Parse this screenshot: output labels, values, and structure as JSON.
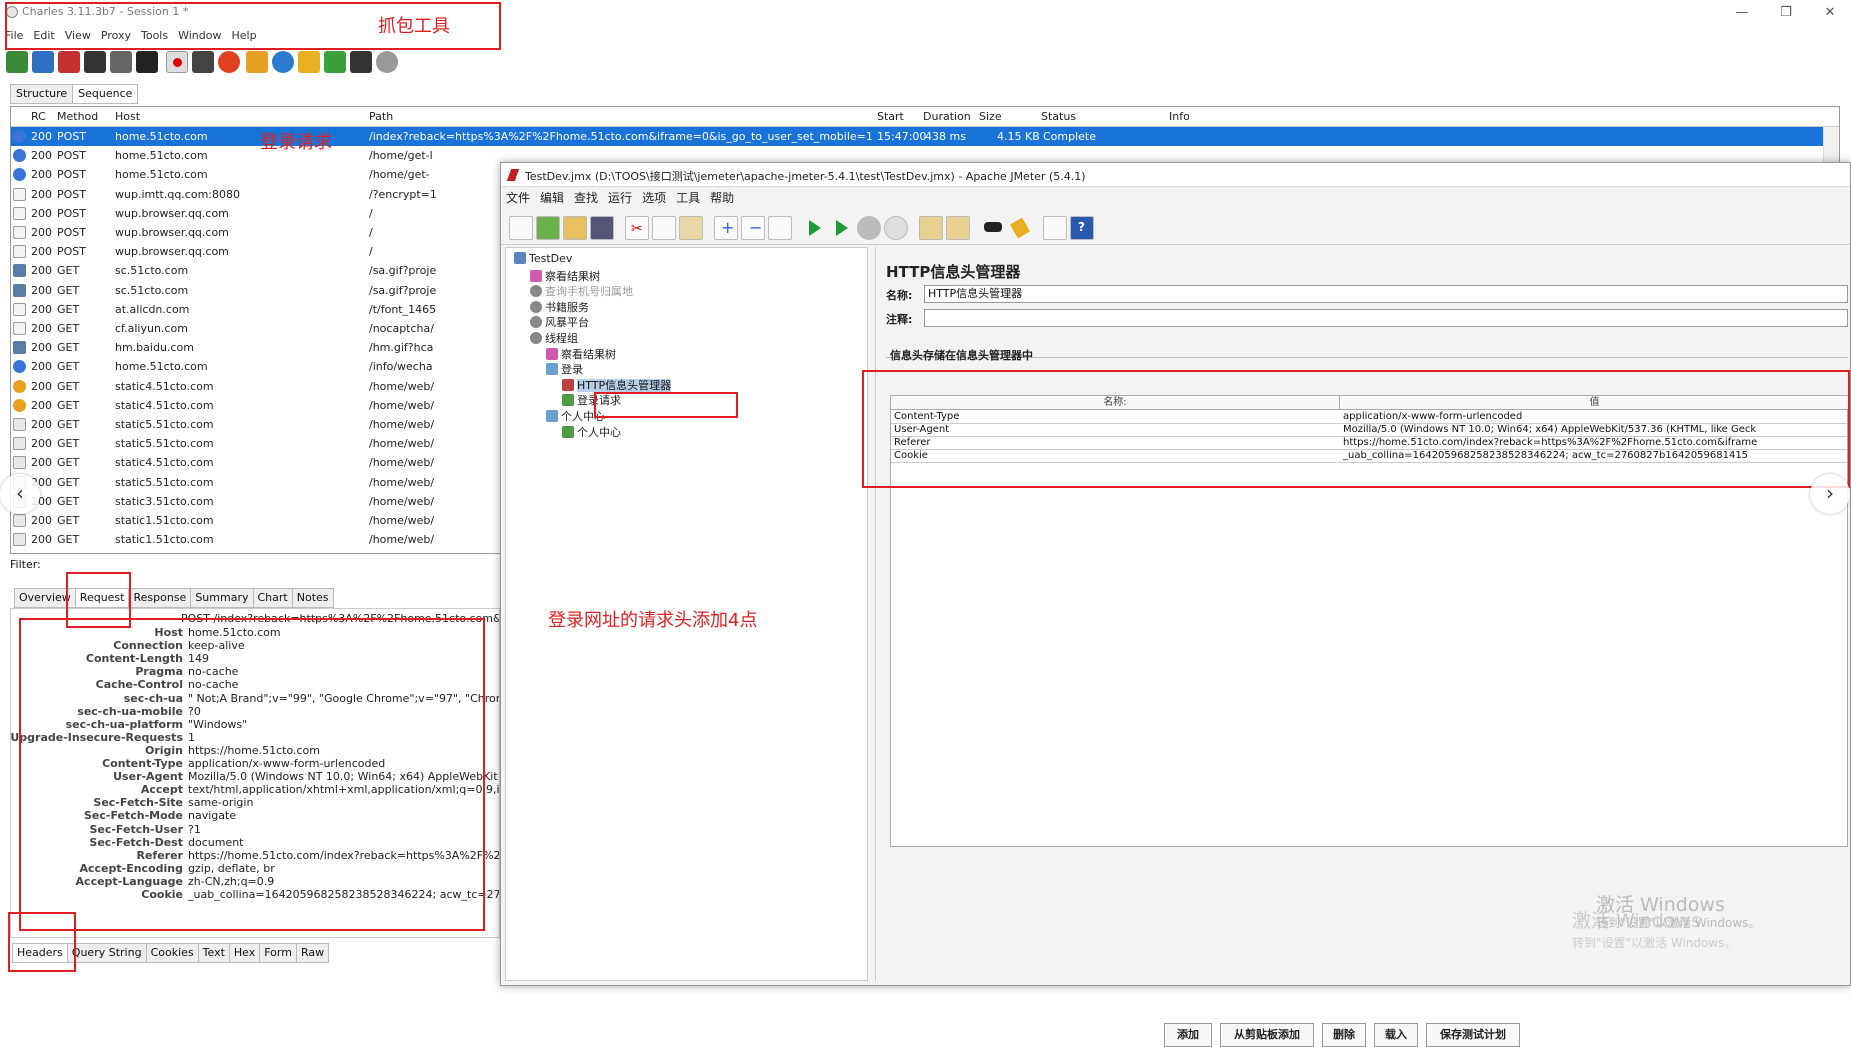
{
  "charles": {
    "title": "Charles 3.11.3b7 - Session 1 *",
    "window_controls": [
      "—",
      "❐",
      "✕"
    ],
    "menu": [
      "File",
      "Edit",
      "View",
      "Proxy",
      "Tools",
      "Window",
      "Help"
    ],
    "view_tabs": [
      "Structure",
      "Sequence"
    ],
    "columns": [
      "RC",
      "Method",
      "Host",
      "Path",
      "Start",
      "Duration",
      "Size",
      "Status",
      "Info"
    ],
    "rows": [
      {
        "rc": "200",
        "method": "POST",
        "host": "home.51cto.com",
        "path": "/index?reback=https%3A%2F%2Fhome.51cto.com&iframe=0&is_go_to_user_set_mobile=1",
        "start": "15:47:00",
        "duration": "438 ms",
        "size": "4.15 KB",
        "status": "Complete",
        "icon": "globe",
        "selected": true
      },
      {
        "rc": "200",
        "method": "POST",
        "host": "home.51cto.com",
        "path": "/home/get-l",
        "icon": "globe"
      },
      {
        "rc": "200",
        "method": "POST",
        "host": "home.51cto.com",
        "path": "/home/get-",
        "icon": "globe"
      },
      {
        "rc": "200",
        "method": "POST",
        "host": "wup.imtt.qq.com:8080",
        "path": "/?encrypt=1",
        "icon": "doc"
      },
      {
        "rc": "200",
        "method": "POST",
        "host": "wup.browser.qq.com",
        "path": "/",
        "icon": "doc"
      },
      {
        "rc": "200",
        "method": "POST",
        "host": "wup.browser.qq.com",
        "path": "/",
        "icon": "doc"
      },
      {
        "rc": "200",
        "method": "POST",
        "host": "wup.browser.qq.com",
        "path": "/",
        "icon": "doc"
      },
      {
        "rc": "200",
        "method": "GET",
        "host": "sc.51cto.com",
        "path": "/sa.gif?proje",
        "icon": "img"
      },
      {
        "rc": "200",
        "method": "GET",
        "host": "sc.51cto.com",
        "path": "/sa.gif?proje",
        "icon": "img"
      },
      {
        "rc": "200",
        "method": "GET",
        "host": "at.alicdn.com",
        "path": "/t/font_1465",
        "icon": "doc"
      },
      {
        "rc": "200",
        "method": "GET",
        "host": "cf.aliyun.com",
        "path": "/nocaptcha/",
        "icon": "doc"
      },
      {
        "rc": "200",
        "method": "GET",
        "host": "hm.baidu.com",
        "path": "/hm.gif?hca",
        "icon": "img"
      },
      {
        "rc": "200",
        "method": "GET",
        "host": "home.51cto.com",
        "path": "/info/wecha",
        "icon": "globe"
      },
      {
        "rc": "200",
        "method": "GET",
        "host": "static4.51cto.com",
        "path": "/home/web/",
        "icon": "chrome"
      },
      {
        "rc": "200",
        "method": "GET",
        "host": "static4.51cto.com",
        "path": "/home/web/",
        "icon": "chrome"
      },
      {
        "rc": "200",
        "method": "GET",
        "host": "static5.51cto.com",
        "path": "/home/web/",
        "icon": "text"
      },
      {
        "rc": "200",
        "method": "GET",
        "host": "static5.51cto.com",
        "path": "/home/web/",
        "icon": "text"
      },
      {
        "rc": "200",
        "method": "GET",
        "host": "static4.51cto.com",
        "path": "/home/web/",
        "icon": "text"
      },
      {
        "rc": "200",
        "method": "GET",
        "host": "static5.51cto.com",
        "path": "/home/web/",
        "icon": "text"
      },
      {
        "rc": "200",
        "method": "GET",
        "host": "static3.51cto.com",
        "path": "/home/web/",
        "icon": "text"
      },
      {
        "rc": "200",
        "method": "GET",
        "host": "static1.51cto.com",
        "path": "/home/web/",
        "icon": "text"
      },
      {
        "rc": "200",
        "method": "GET",
        "host": "static1.51cto.com",
        "path": "/home/web/",
        "icon": "text"
      }
    ],
    "filter_label": "Filter:",
    "detail_tabs": [
      "Overview",
      "Request",
      "Response",
      "Summary",
      "Chart",
      "Notes"
    ],
    "request_line": "POST /index?reback=https%3A%2F%2Fhome.51cto.com&",
    "headers": [
      {
        "k": "Host",
        "v": "home.51cto.com"
      },
      {
        "k": "Connection",
        "v": "keep-alive"
      },
      {
        "k": "Content-Length",
        "v": "149"
      },
      {
        "k": "Pragma",
        "v": "no-cache"
      },
      {
        "k": "Cache-Control",
        "v": "no-cache"
      },
      {
        "k": "sec-ch-ua",
        "v": "\" Not;A Brand\";v=\"99\", \"Google Chrome\";v=\"97\", \"Chrom"
      },
      {
        "k": "sec-ch-ua-mobile",
        "v": "?0"
      },
      {
        "k": "sec-ch-ua-platform",
        "v": "\"Windows\""
      },
      {
        "k": "Upgrade-Insecure-Requests",
        "v": "1"
      },
      {
        "k": "Origin",
        "v": "https://home.51cto.com"
      },
      {
        "k": "Content-Type",
        "v": "application/x-www-form-urlencoded"
      },
      {
        "k": "User-Agent",
        "v": "Mozilla/5.0 (Windows NT 10.0; Win64; x64) AppleWebKit"
      },
      {
        "k": "Accept",
        "v": "text/html,application/xhtml+xml,application/xml;q=0.9,im"
      },
      {
        "k": "Sec-Fetch-Site",
        "v": "same-origin"
      },
      {
        "k": "Sec-Fetch-Mode",
        "v": "navigate"
      },
      {
        "k": "Sec-Fetch-User",
        "v": "?1"
      },
      {
        "k": "Sec-Fetch-Dest",
        "v": "document"
      },
      {
        "k": "Referer",
        "v": "https://home.51cto.com/index?reback=https%3A%2F%2F"
      },
      {
        "k": "Accept-Encoding",
        "v": "gzip, deflate, br"
      },
      {
        "k": "Accept-Language",
        "v": "zh-CN,zh;q=0.9"
      },
      {
        "k": "Cookie",
        "v": "_uab_collina=164205968258238528346224; acw_tc=2760"
      }
    ],
    "bottom_tabs": [
      "Headers",
      "Query String",
      "Cookies",
      "Text",
      "Hex",
      "Form",
      "Raw"
    ]
  },
  "annotations": {
    "capture_tool": "抓包工具",
    "login_request": "登录请求",
    "add_headers": "登录网址的请求头添加4点"
  },
  "jmeter": {
    "title": "TestDev.jmx (D:\\TOOS\\接口测试\\jemeter\\apache-jmeter-5.4.1\\test\\TestDev.jmx) - Apache JMeter (5.4.1)",
    "menu": [
      "文件",
      "编辑",
      "查找",
      "运行",
      "选项",
      "工具",
      "帮助"
    ],
    "tree": [
      {
        "label": "TestDev",
        "indent": 0,
        "icon": "flask"
      },
      {
        "label": "察看结果树",
        "indent": 1,
        "icon": "chart"
      },
      {
        "label": "查询手机号归属地",
        "indent": 1,
        "icon": "gear",
        "disabled": true
      },
      {
        "label": "书籍服务",
        "indent": 1,
        "icon": "gear"
      },
      {
        "label": "风暴平台",
        "indent": 1,
        "icon": "gear"
      },
      {
        "label": "线程组",
        "indent": 1,
        "icon": "gear"
      },
      {
        "label": "察看结果树",
        "indent": 2,
        "icon": "chart"
      },
      {
        "label": "登录",
        "indent": 2,
        "icon": "controller"
      },
      {
        "label": "HTTP信息头管理器",
        "indent": 3,
        "icon": "wrench",
        "selected": true
      },
      {
        "label": "登录请求",
        "indent": 3,
        "icon": "pipette"
      },
      {
        "label": "个人中心",
        "indent": 2,
        "icon": "controller"
      },
      {
        "label": "个人中心",
        "indent": 3,
        "icon": "pipette"
      }
    ],
    "panel_title": "HTTP信息头管理器",
    "name_label": "名称:",
    "name_value": "HTTP信息头管理器",
    "comment_label": "注释:",
    "comment_value": "",
    "group_title": "信息头存储在信息头管理器中",
    "table_headers": [
      "名称:",
      "值"
    ],
    "table_rows": [
      {
        "name": "Content-Type",
        "value": "application/x-www-form-urlencoded"
      },
      {
        "name": "User-Agent",
        "value": "Mozilla/5.0 (Windows NT 10.0; Win64; x64) AppleWebKit/537.36 (KHTML, like Geck"
      },
      {
        "name": "Referer",
        "value": "https://home.51cto.com/index?reback=https%3A%2F%2Fhome.51cto.com&iframe"
      },
      {
        "name": "Cookie",
        "value": "_uab_collina=164205968258238528346224; acw_tc=2760827b1642059681415"
      }
    ],
    "buttons": [
      "添加",
      "从剪贴板添加",
      "删除",
      "载入",
      "保存测试计划"
    ]
  },
  "watermark": {
    "line1": "激活 Windows",
    "line2": "转到\"设置\"以激活 Windows。",
    "line3": "激活 Windows",
    "line4": "转到\"设置\"以激活 Windows。"
  },
  "nav": {
    "prev": "‹",
    "next": "›"
  }
}
